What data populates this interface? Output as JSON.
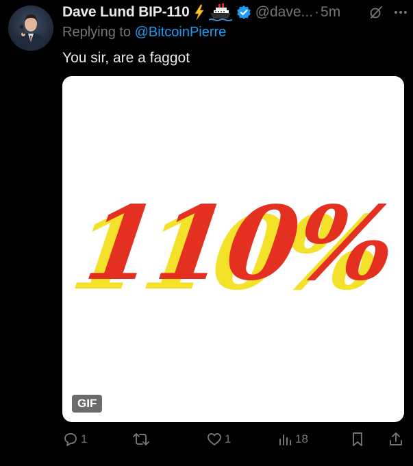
{
  "tweet": {
    "author_name": "Dave Lund BIP-110",
    "handle": "@dave...",
    "separator": "·",
    "time": "5m",
    "replying_prefix": "Replying to",
    "replying_to": "@BitcoinPierre",
    "text": "You sir, are a faggot",
    "media": {
      "badge": "GIF",
      "gif_text": "110%"
    }
  },
  "actions": {
    "reply_count": "1",
    "like_count": "1",
    "views_count": "18"
  },
  "icons": {
    "lightning": "lightning-emoji-icon",
    "ship": "ship-emoji-icon",
    "verified": "verified-badge-icon",
    "grok": "grok-icon",
    "more": "more-icon",
    "reply": "reply-icon",
    "retweet": "retweet-icon",
    "like": "like-icon",
    "views": "views-icon",
    "bookmark": "bookmark-icon",
    "share": "share-icon"
  },
  "colors": {
    "background": "#000000",
    "text": "#e7e9ea",
    "muted": "#71767b",
    "link": "#1d9bf0",
    "verified": "#1d9bf0",
    "gif_red": "#e33021",
    "gif_yellow": "#f3e12a"
  }
}
